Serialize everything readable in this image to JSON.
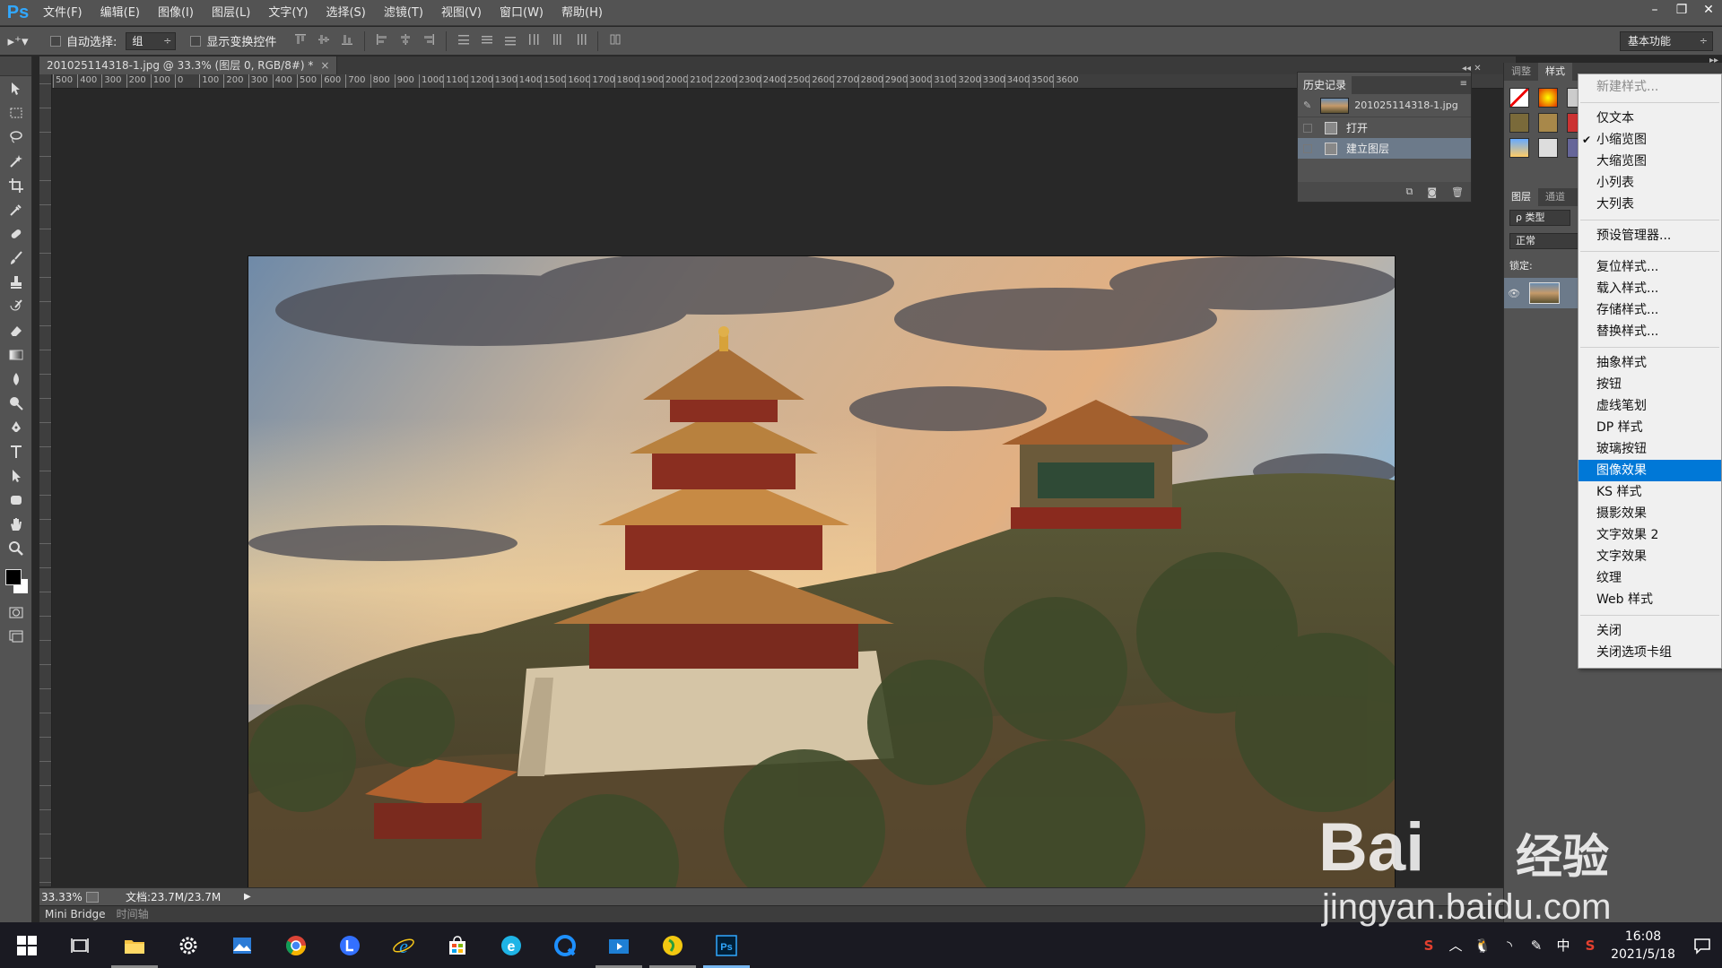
{
  "app": {
    "logo": "Ps"
  },
  "menu": [
    "文件(F)",
    "编辑(E)",
    "图像(I)",
    "图层(L)",
    "文字(Y)",
    "选择(S)",
    "滤镜(T)",
    "视图(V)",
    "窗口(W)",
    "帮助(H)"
  ],
  "window_controls": [
    "–",
    "❐",
    "✕"
  ],
  "options": {
    "auto_select_label": "自动选择:",
    "auto_select_value": "组",
    "transform_label": "显示变换控件",
    "workspace": "基本功能"
  },
  "document": {
    "tab_title": "201025114318-1.jpg @ 33.3% (图层 0, RGB/8#) *",
    "ruler_labels": [
      "500",
      "400",
      "300",
      "200",
      "100",
      "0",
      "100",
      "200",
      "300",
      "400",
      "500",
      "600",
      "700",
      "800",
      "900",
      "1000",
      "1100",
      "1200",
      "1300",
      "1400",
      "1500",
      "1600",
      "1700",
      "1800",
      "1900",
      "2000",
      "2100",
      "2200",
      "2300",
      "2400",
      "2500",
      "2600",
      "2700",
      "2800",
      "2900",
      "3000",
      "3100",
      "3200",
      "3300",
      "3400",
      "3500",
      "3600"
    ],
    "zoom": "33.33%",
    "doc_info": "文档:23.7M/23.7M"
  },
  "bottom_tabs": [
    "Mini Bridge",
    "时间轴"
  ],
  "history": {
    "title": "历史记录",
    "snapshot": "201025114318-1.jpg",
    "steps": [
      {
        "label": "打开"
      },
      {
        "label": "建立图层"
      }
    ]
  },
  "right_panel": {
    "tabs": [
      "调整",
      "样式"
    ],
    "layer_tabs": [
      "图层",
      "通道"
    ],
    "filter": "ρ 类型",
    "blend": "正常",
    "lock_label": "锁定:"
  },
  "context_menu": {
    "items": [
      {
        "label": "新建样式...",
        "state": "disabled"
      },
      {
        "sep": true
      },
      {
        "label": "仅文本"
      },
      {
        "label": "小缩览图",
        "checked": true
      },
      {
        "label": "大缩览图"
      },
      {
        "label": "小列表"
      },
      {
        "label": "大列表"
      },
      {
        "sep": true
      },
      {
        "label": "预设管理器..."
      },
      {
        "sep": true
      },
      {
        "label": "复位样式..."
      },
      {
        "label": "载入样式..."
      },
      {
        "label": "存储样式..."
      },
      {
        "label": "替换样式..."
      },
      {
        "sep": true
      },
      {
        "label": "抽象样式"
      },
      {
        "label": "按钮"
      },
      {
        "label": "虚线笔划"
      },
      {
        "label": "DP 样式"
      },
      {
        "label": "玻璃按钮"
      },
      {
        "label": "图像效果",
        "highlighted": true
      },
      {
        "label": "KS 样式"
      },
      {
        "label": "摄影效果"
      },
      {
        "label": "文字效果 2"
      },
      {
        "label": "文字效果"
      },
      {
        "label": "纹理"
      },
      {
        "label": "Web 样式"
      },
      {
        "sep": true
      },
      {
        "label": "关闭"
      },
      {
        "label": "关闭选项卡组"
      }
    ]
  },
  "taskbar": {
    "apps": [
      "windows-start",
      "task-view",
      "file-explorer",
      "settings",
      "photos",
      "chrome",
      "lark",
      "ie",
      "store",
      "edge",
      "qq-browser",
      "video",
      "music",
      "photoshop"
    ],
    "tray": {
      "ime": "中",
      "time": "16:08",
      "date": "2021/5/18"
    }
  },
  "watermark": {
    "brand": "Bai",
    "cn": "经验",
    "url": "jingyan.baidu.com"
  },
  "colors": {
    "accent": "#0078d7",
    "ps_blue": "#31a8ff",
    "panel": "#535353"
  }
}
